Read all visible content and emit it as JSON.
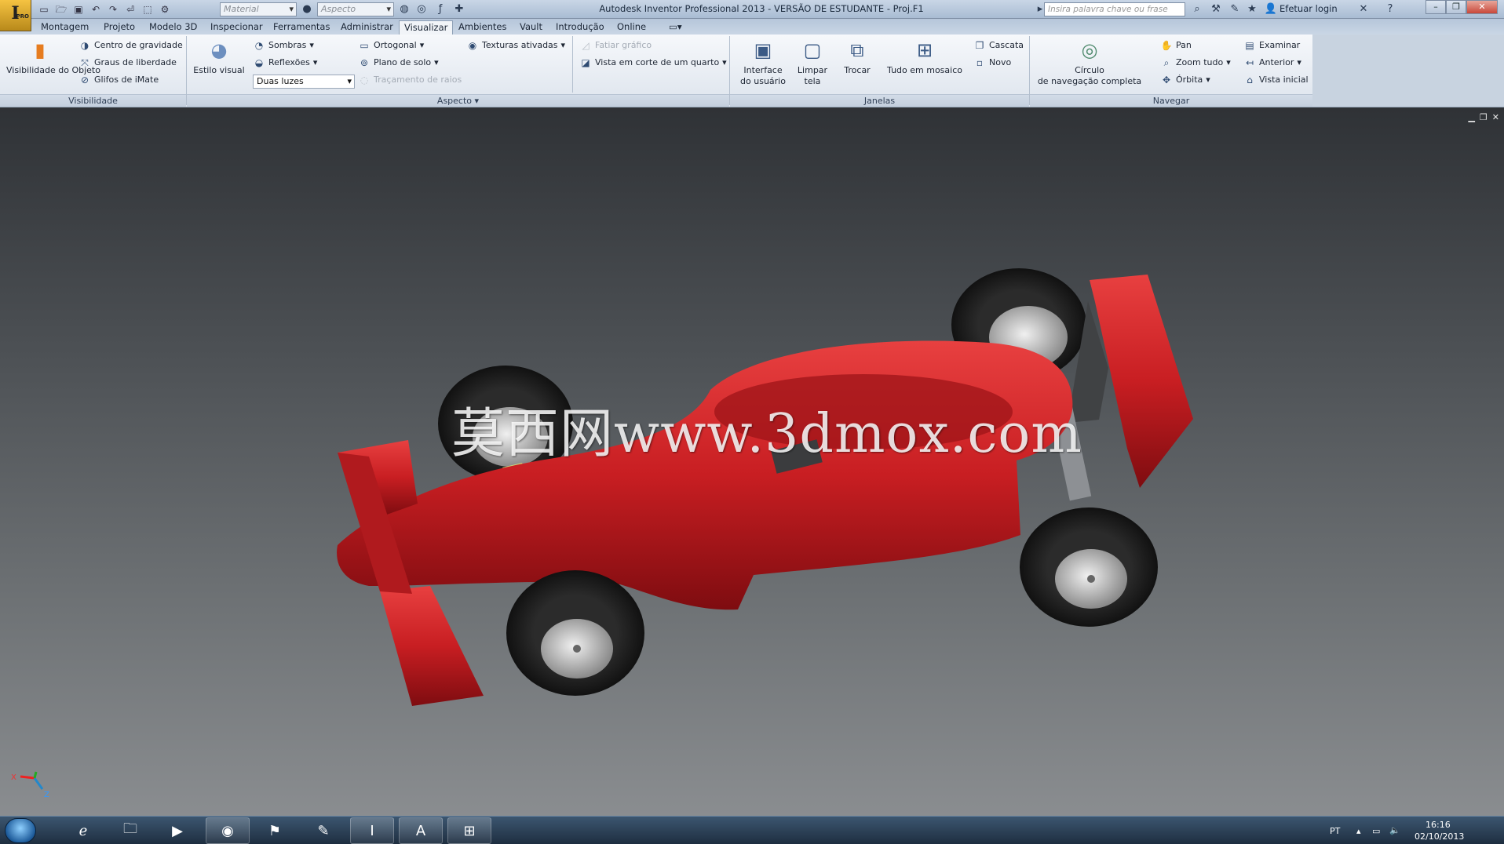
{
  "window": {
    "title": "Autodesk Inventor Professional 2013 - VERSÃO DE ESTUDANTE - Proj.F1",
    "search_placeholder": "Insira palavra chave ou frase",
    "login_label": "Efetuar login",
    "app_letter": "I",
    "app_badge": "PRO"
  },
  "qat": {
    "material_placeholder": "Material",
    "aspect_placeholder": "Aspecto"
  },
  "menu_tabs": [
    "Montagem",
    "Projeto",
    "Modelo 3D",
    "Inspecionar",
    "Ferramentas",
    "Administrar",
    "Visualizar",
    "Ambientes",
    "Vault",
    "Introdução",
    "Online"
  ],
  "active_tab": "Visualizar",
  "ribbon": {
    "visibility": {
      "panel_label": "Visibilidade",
      "object_visibility": "Visibilidade do Objeto",
      "center_of_gravity": "Centro de gravidade",
      "degrees_of_freedom": "Graus de liberdade",
      "imate_glyphs": "Glifos de iMate"
    },
    "appearance": {
      "panel_label": "Aspecto",
      "visual_style": "Estilo visual",
      "shadows": "Sombras",
      "reflections": "Reflexões",
      "lighting": "Duas luzes",
      "orthographic": "Ortogonal",
      "ground_plane": "Plano de solo",
      "ray_tracing": "Traçamento de raios",
      "textures_on": "Texturas ativadas",
      "slice_graphics": "Fatiar gráfico",
      "quarter_section": "Vista em corte de um quarto"
    },
    "windows": {
      "panel_label": "Janelas",
      "user_interface": "Interface do usuário",
      "clean_screen": "Limpar tela",
      "switch": "Trocar",
      "tile_all": "Tudo em mosaico",
      "cascade": "Cascata",
      "new": "Novo"
    },
    "navigate": {
      "panel_label": "Navegar",
      "nav_wheel_line1": "Círculo",
      "nav_wheel_line2": "de navegação completa",
      "pan": "Pan",
      "zoom_all": "Zoom tudo",
      "orbit": "Órbita",
      "examine": "Examinar",
      "previous": "Anterior",
      "home_view": "Vista inicial"
    }
  },
  "viewport": {
    "watermark": "莫西网www.3dmox.com",
    "axis_x": "X",
    "axis_z": "Z",
    "model_color": "#c81e22"
  },
  "taskbar": {
    "apps": [
      "internet-explorer-icon",
      "file-explorer-icon",
      "media-player-icon",
      "chrome-icon",
      "3ds-max-icon",
      "paint-icon",
      "inventor-icon",
      "autocad-icon",
      "app-icon"
    ],
    "language": "PT",
    "time": "16:16",
    "date": "02/10/2013"
  }
}
